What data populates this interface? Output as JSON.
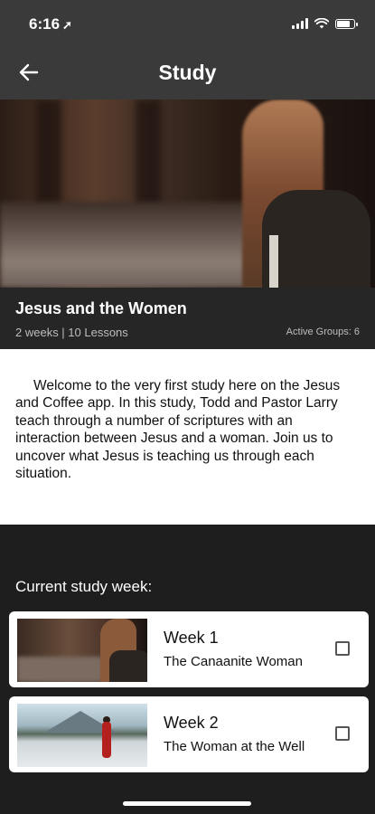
{
  "status_bar": {
    "time": "6:16"
  },
  "header": {
    "title": "Study"
  },
  "study": {
    "title": "Jesus and the Women",
    "meta": "2 weeks | 10 Lessons",
    "active_groups": "Active Groups: 6",
    "description": "Welcome to the very first study here on the Jesus and Coffee app.  In this study, Todd and Pastor Larry teach through a number of scriptures with an interaction between Jesus and a woman.  Join us to uncover what Jesus is teaching us through each situation."
  },
  "week_section": {
    "label": "Current study week:",
    "weeks": [
      {
        "name": "Week 1",
        "subtitle": "The Canaanite Woman",
        "checked": false
      },
      {
        "name": "Week 2",
        "subtitle": "The Woman at the Well",
        "checked": false
      }
    ]
  },
  "colors": {
    "bar_bg": "#3a3a3a",
    "panel_bg": "#262626",
    "page_bg": "#1e1e1e"
  }
}
